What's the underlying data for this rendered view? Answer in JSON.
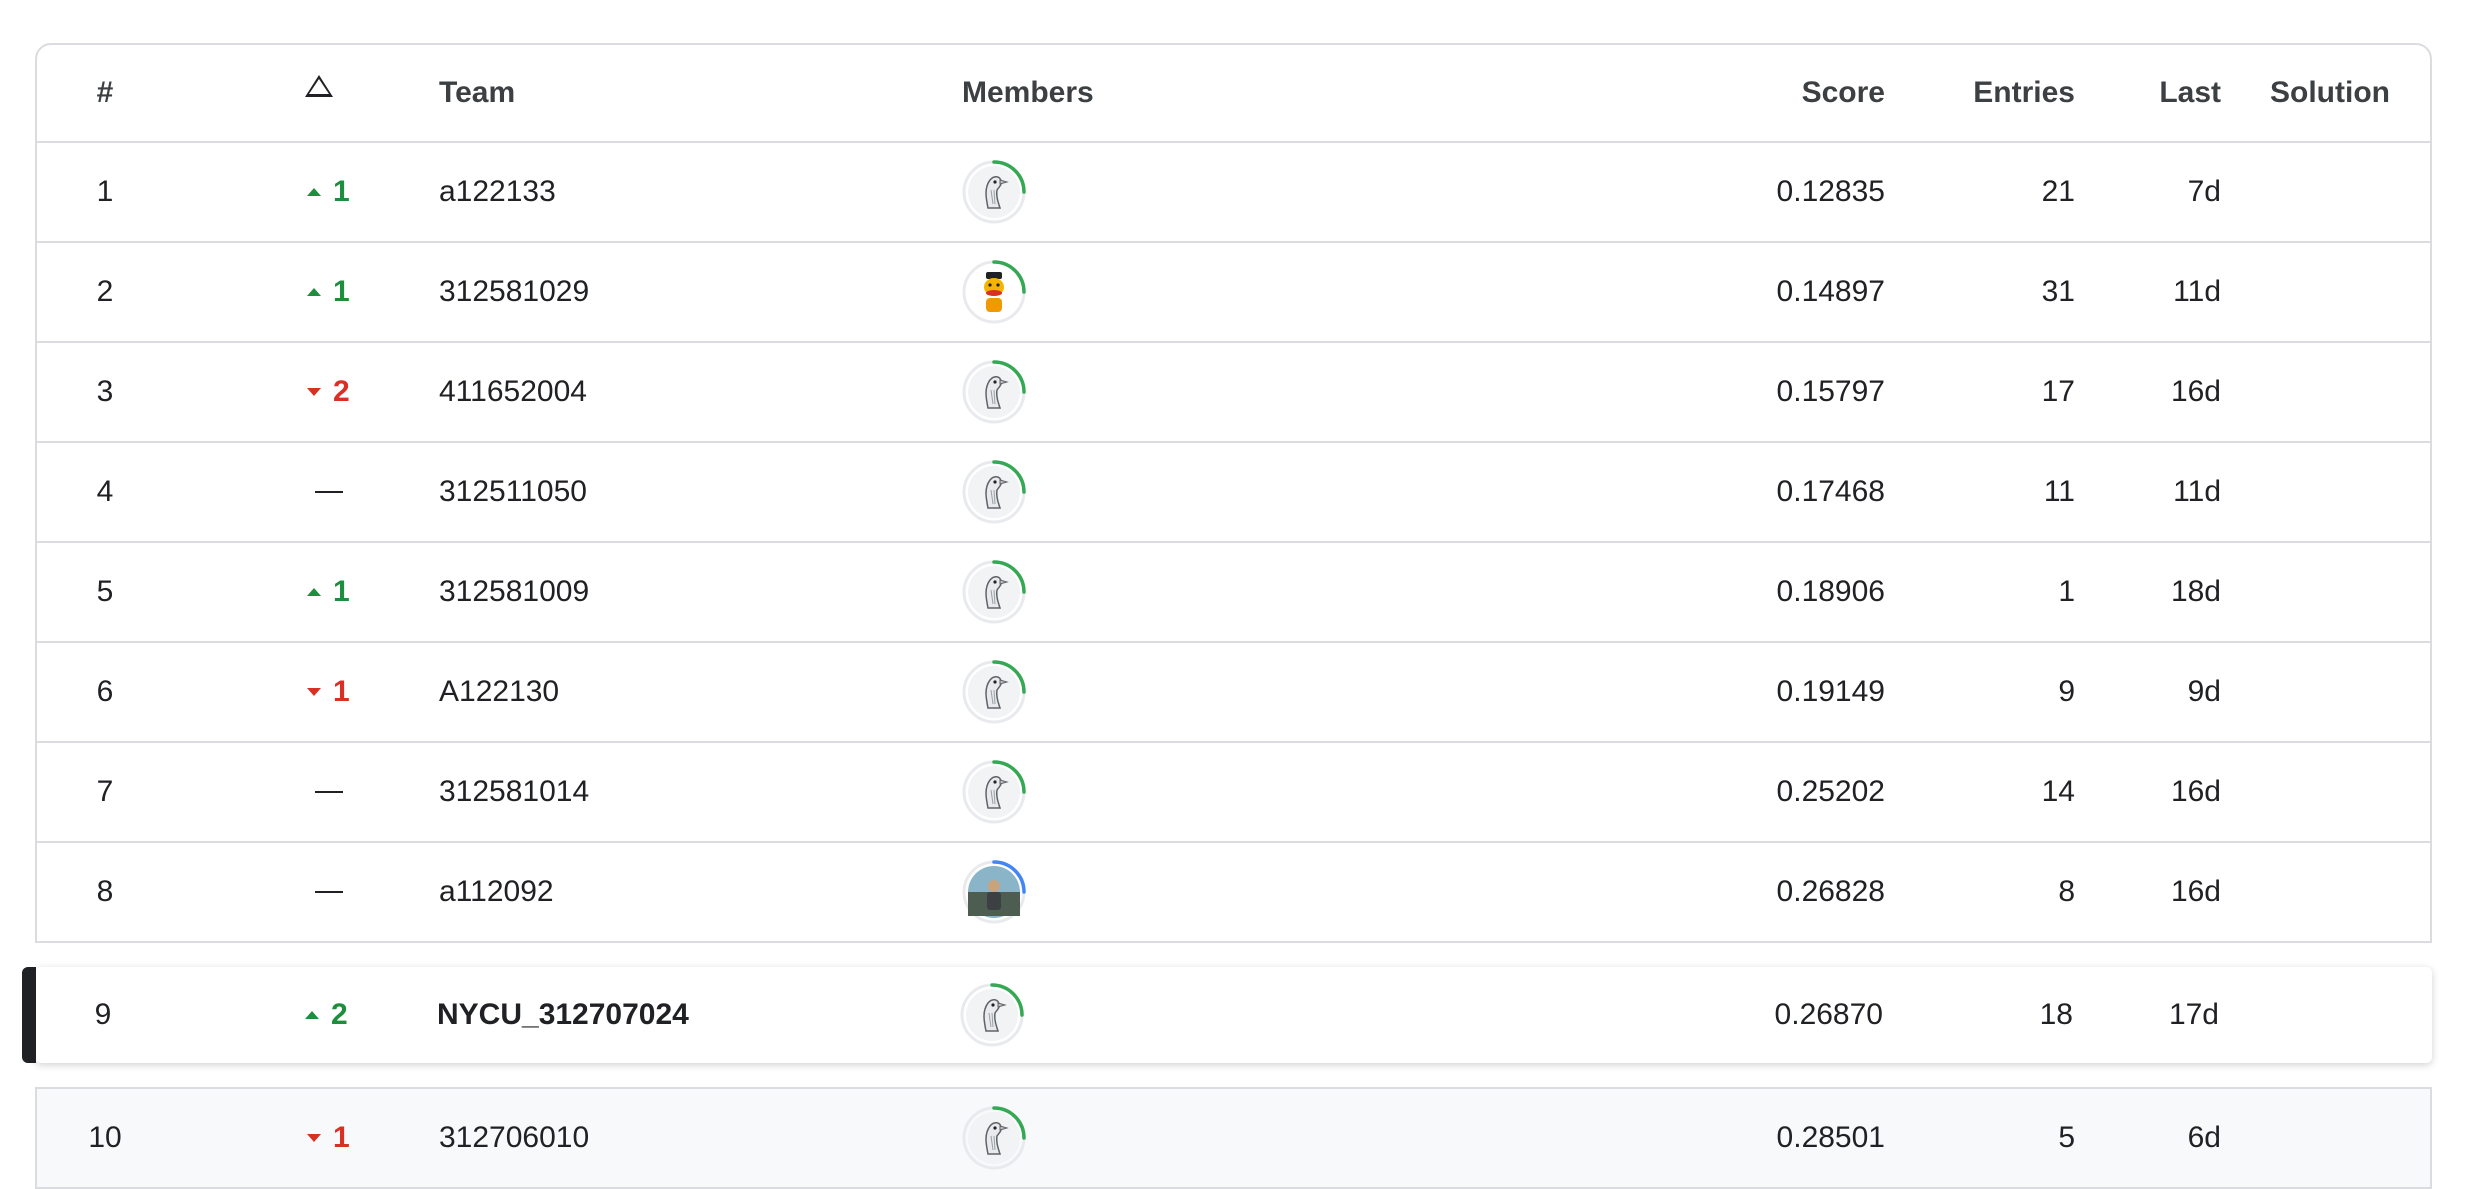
{
  "header": {
    "rank": "#",
    "delta_icon": "triangle-icon",
    "team": "Team",
    "members": "Members",
    "score": "Score",
    "entries": "Entries",
    "last": "Last",
    "solution": "Solution"
  },
  "rows": [
    {
      "rank": "1",
      "dir": "up",
      "delta": "1",
      "team": "a122133",
      "avatar": "goose",
      "ring": "#34a853",
      "score": "0.12835",
      "entries": "21",
      "last": "7d"
    },
    {
      "rank": "2",
      "dir": "up",
      "delta": "1",
      "team": "312581029",
      "avatar": "bert",
      "ring": "#34a853",
      "score": "0.14897",
      "entries": "31",
      "last": "11d"
    },
    {
      "rank": "3",
      "dir": "down",
      "delta": "2",
      "team": "411652004",
      "avatar": "goose",
      "ring": "#34a853",
      "score": "0.15797",
      "entries": "17",
      "last": "16d"
    },
    {
      "rank": "4",
      "dir": "same",
      "delta": "",
      "team": "312511050",
      "avatar": "goose",
      "ring": "#34a853",
      "score": "0.17468",
      "entries": "11",
      "last": "11d"
    },
    {
      "rank": "5",
      "dir": "up",
      "delta": "1",
      "team": "312581009",
      "avatar": "goose",
      "ring": "#34a853",
      "score": "0.18906",
      "entries": "1",
      "last": "18d"
    },
    {
      "rank": "6",
      "dir": "down",
      "delta": "1",
      "team": "A122130",
      "avatar": "goose",
      "ring": "#34a853",
      "score": "0.19149",
      "entries": "9",
      "last": "9d"
    },
    {
      "rank": "7",
      "dir": "same",
      "delta": "",
      "team": "312581014",
      "avatar": "goose",
      "ring": "#34a853",
      "score": "0.25202",
      "entries": "14",
      "last": "16d"
    },
    {
      "rank": "8",
      "dir": "same",
      "delta": "",
      "team": "a112092",
      "avatar": "photo",
      "ring": "#4285f4",
      "score": "0.26828",
      "entries": "8",
      "last": "16d"
    }
  ],
  "my_row": {
    "rank": "9",
    "dir": "up",
    "delta": "2",
    "team": "NYCU_312707024",
    "avatar": "goose",
    "ring": "#34a853",
    "score": "0.26870",
    "entries": "18",
    "last": "17d"
  },
  "bottom_rows": [
    {
      "rank": "10",
      "dir": "down",
      "delta": "1",
      "team": "312706010",
      "avatar": "goose",
      "ring": "#34a853",
      "score": "0.28501",
      "entries": "5",
      "last": "6d"
    }
  ],
  "colors": {
    "up": "#1e8e3e",
    "down": "#d93025",
    "accent": "#202124"
  }
}
